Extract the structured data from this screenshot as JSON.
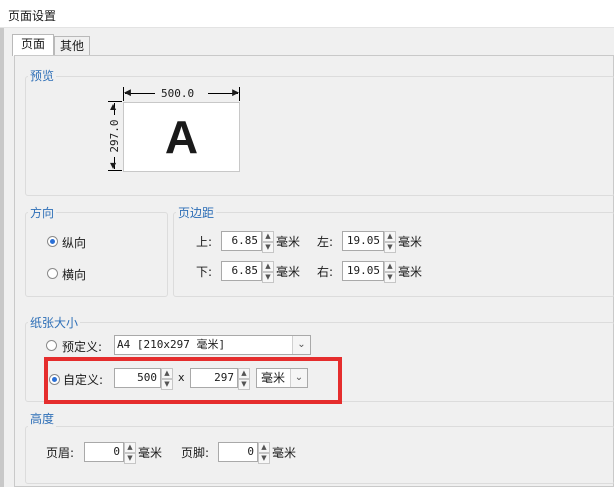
{
  "window": {
    "title": "页面设置"
  },
  "tabs": [
    {
      "label": "页面"
    },
    {
      "label": "其他"
    }
  ],
  "preview": {
    "group_label": "预览",
    "width_dim": "500.0",
    "height_dim": "297.0",
    "letter": "A"
  },
  "orientation": {
    "group_label": "方向",
    "portrait_label": "纵向",
    "landscape_label": "横向",
    "selected": "纵向"
  },
  "margins": {
    "group_label": "页边距",
    "top_label": "上:",
    "top_value": "6.85",
    "bottom_label": "下:",
    "bottom_value": "6.85",
    "left_label": "左:",
    "left_value": "19.05",
    "right_label": "右:",
    "right_value": "19.05",
    "unit": "毫米"
  },
  "paper": {
    "group_label": "纸张大小",
    "predefined_label": "预定义:",
    "predefined_value": "A4 [210x297 毫米]",
    "custom_label": "自定义:",
    "custom_width": "500",
    "x_label": "x",
    "custom_height": "297",
    "custom_unit": "毫米",
    "selected": "自定义"
  },
  "height_section": {
    "group_label": "高度",
    "header_label": "页眉:",
    "header_value": "0",
    "footer_label": "页脚:",
    "footer_value": "0",
    "unit": "毫米"
  },
  "colors": {
    "accent": "#2e6fb7",
    "highlight": "#e52d2d"
  }
}
